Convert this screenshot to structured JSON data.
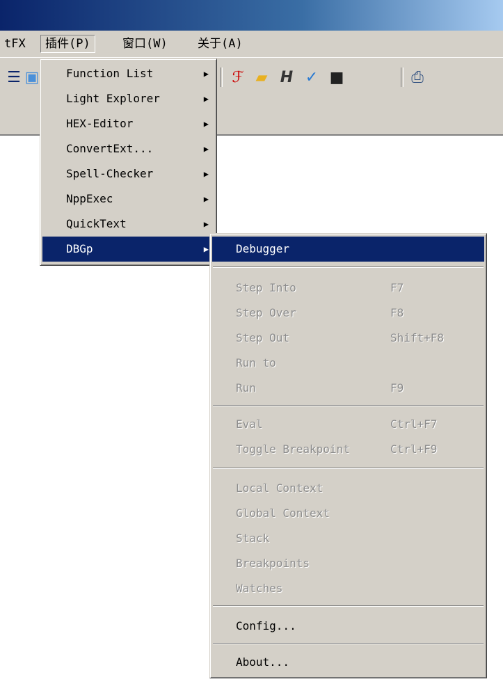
{
  "menubar": {
    "items": [
      {
        "label": "tFX"
      },
      {
        "label": "插件(P)"
      },
      {
        "label": "窗口(W)"
      },
      {
        "label": "关于(A)"
      }
    ]
  },
  "toolbar": {
    "icons": [
      "format-icon",
      "image-icon",
      "pdf-icon",
      "folder-icon",
      "heading-h-icon",
      "spellcheck-abc-icon",
      "console-icon",
      "print-icon"
    ]
  },
  "plugins_menu": {
    "items": [
      {
        "label": "Function List"
      },
      {
        "label": "Light Explorer"
      },
      {
        "label": "HEX-Editor"
      },
      {
        "label": "ConvertExt..."
      },
      {
        "label": "Spell-Checker"
      },
      {
        "label": "NppExec"
      },
      {
        "label": "QuickText"
      },
      {
        "label": "DBGp"
      }
    ],
    "arrow": "▶"
  },
  "dbgp_menu": {
    "debugger": "Debugger",
    "step_into": {
      "label": "Step Into",
      "shortcut": "F7"
    },
    "step_over": {
      "label": "Step Over",
      "shortcut": "F8"
    },
    "step_out": {
      "label": "Step Out",
      "shortcut": "Shift+F8"
    },
    "run_to": {
      "label": "Run to"
    },
    "run": {
      "label": "Run",
      "shortcut": "F9"
    },
    "eval": {
      "label": "Eval",
      "shortcut": "Ctrl+F7"
    },
    "toggle_breakpoint": {
      "label": "Toggle Breakpoint",
      "shortcut": "Ctrl+F9"
    },
    "local_context": "Local Context",
    "global_context": "Global Context",
    "stack": "Stack",
    "breakpoints": "Breakpoints",
    "watches": "Watches",
    "config": "Config...",
    "about": "About..."
  }
}
